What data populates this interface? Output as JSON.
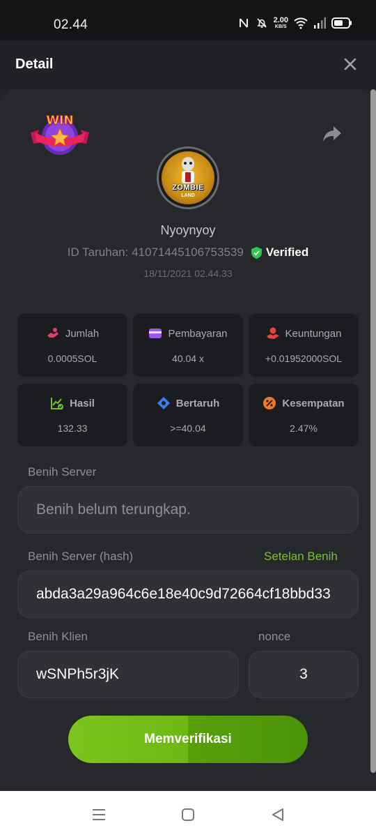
{
  "status_bar": {
    "time": "02.44",
    "net_speed_value": "2.00",
    "net_speed_unit": "KB/S"
  },
  "header": {
    "title": "Detail"
  },
  "badge": {
    "text": "WIN"
  },
  "avatar": {
    "text_top": "ZOMBIE",
    "text_bottom": "LAND"
  },
  "user": {
    "name": "Nyoynyoy",
    "bet_id_label": "ID Taruhan:",
    "bet_id": "41071445106753539",
    "verified_label": "Verified",
    "datetime": "18/11/2021 02.44.33"
  },
  "stats": [
    {
      "label": "Jumlah",
      "value": "0.0005SOL",
      "icon": "money-hand-icon",
      "color": "#e0406a"
    },
    {
      "label": "Pembayaran",
      "value": "40.04 x",
      "icon": "card-icon",
      "color": "#9b59f0"
    },
    {
      "label": "Keuntungan",
      "value": "+0.01952000SOL",
      "icon": "coin-hand-icon",
      "color": "#e8443a"
    },
    {
      "label": "Hasil",
      "value": "132.33",
      "icon": "chart-check-icon",
      "color": "#6cc42a"
    },
    {
      "label": "Bertaruh",
      "value": ">=40.04",
      "icon": "tag-icon",
      "color": "#3b7cf0"
    },
    {
      "label": "Kesempatan",
      "value": "2.47%",
      "icon": "percent-icon",
      "color": "#f07a22"
    }
  ],
  "fields": {
    "server_seed_label": "Benih Server",
    "server_seed_value": "Benih belum terungkap.",
    "server_hash_label": "Benih Server (hash)",
    "seed_settings_link": "Setelan Benih",
    "server_hash_value": "abda3a29a964c6e18e40c9d72664cf18bbd33",
    "client_seed_label": "Benih Klien",
    "client_seed_value": "wSNPh5r3jK",
    "nonce_label": "nonce",
    "nonce_value": "3"
  },
  "verify_button": {
    "label": "Memverifikasi"
  },
  "colors": {
    "accent_green": "#78c32a",
    "verified_green": "#2bc84a",
    "background": "#202226",
    "card": "#26282c"
  }
}
